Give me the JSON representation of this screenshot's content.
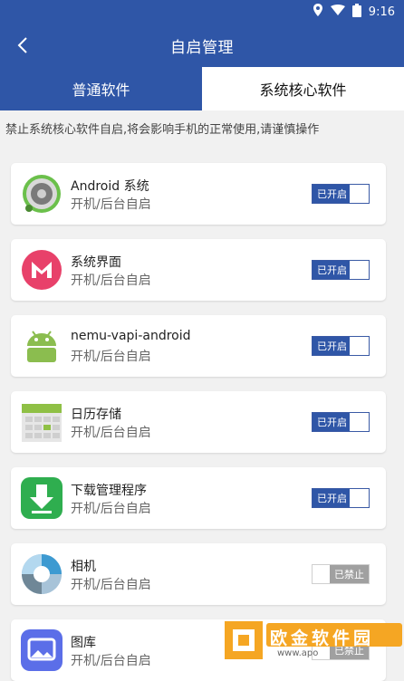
{
  "status": {
    "time": "9:16"
  },
  "header": {
    "title": "自启管理"
  },
  "tabs": [
    {
      "label": "普通软件",
      "selected": false
    },
    {
      "label": "系统核心软件",
      "selected": true
    }
  ],
  "notice": "禁止系统核心软件自启,将会影响手机的正常使用,请谨慎操作",
  "apps": [
    {
      "name": "Android 系统",
      "subtitle": "开机/后台自启",
      "toggle_label": "已开启",
      "enabled": true,
      "icon": "android-system-icon"
    },
    {
      "name": "系统界面",
      "subtitle": "开机/后台自启",
      "toggle_label": "已开启",
      "enabled": true,
      "icon": "system-ui-icon"
    },
    {
      "name": "nemu-vapi-android",
      "subtitle": "开机/后台自启",
      "toggle_label": "已开启",
      "enabled": true,
      "icon": "android-robot-icon"
    },
    {
      "name": "日历存储",
      "subtitle": "开机/后台自启",
      "toggle_label": "已开启",
      "enabled": true,
      "icon": "calendar-storage-icon"
    },
    {
      "name": "下载管理程序",
      "subtitle": "开机/后台自启",
      "toggle_label": "已开启",
      "enabled": true,
      "icon": "download-manager-icon"
    },
    {
      "name": "相机",
      "subtitle": "开机/后台自启",
      "toggle_label": "已禁止",
      "enabled": false,
      "icon": "camera-icon"
    },
    {
      "name": "图库",
      "subtitle": "开机/后台自启",
      "toggle_label": "已禁止",
      "enabled": false,
      "icon": "gallery-icon"
    }
  ],
  "watermark": {
    "text": "欧金软件园",
    "url": "www.apo"
  },
  "colors": {
    "primary": "#2f56a7",
    "disabled": "#a0a0a0",
    "background": "#f1f1f1"
  }
}
